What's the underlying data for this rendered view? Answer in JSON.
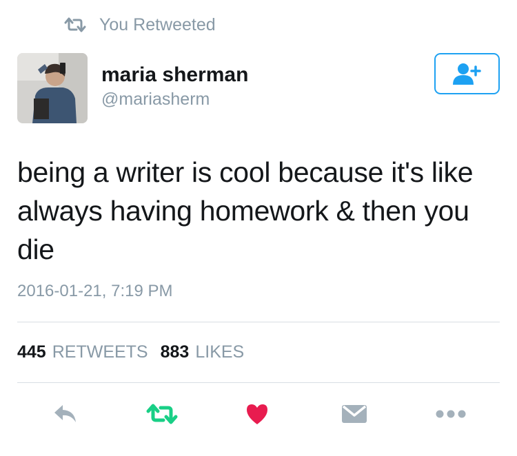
{
  "banner": {
    "text": "You Retweeted",
    "icon": "retweet-icon"
  },
  "user": {
    "name": "maria sherman",
    "handle": "@mariasherm",
    "avatar_icon": "avatar"
  },
  "follow_button": {
    "icon": "add-user-icon"
  },
  "tweet": {
    "text": "being a writer is cool because it's like always having homework & then you die",
    "timestamp": "2016-01-21, 7:19 PM"
  },
  "stats": {
    "retweets_count": "445",
    "retweets_label": "RETWEETS",
    "likes_count": "883",
    "likes_label": "LIKES"
  },
  "actions": [
    {
      "name": "reply",
      "icon": "reply-icon"
    },
    {
      "name": "retweet",
      "icon": "retweet-icon",
      "active": true
    },
    {
      "name": "like",
      "icon": "heart-icon",
      "active": true
    },
    {
      "name": "direct-message",
      "icon": "envelope-icon"
    },
    {
      "name": "more",
      "icon": "more-icon"
    }
  ],
  "colors": {
    "accent": "#1da1f2",
    "retweet_green": "#19cf86",
    "like_red": "#e81c4f",
    "muted": "#8899a6",
    "action_gray": "#a4b1bb"
  }
}
